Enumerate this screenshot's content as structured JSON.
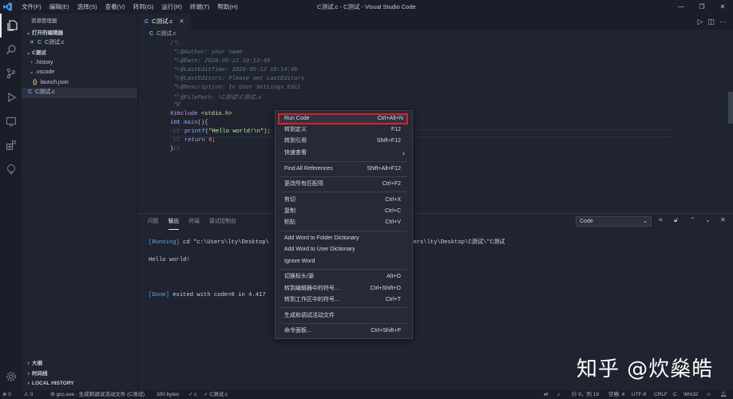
{
  "titlebar": {
    "menu": [
      "文件(F)",
      "编辑(E)",
      "选择(S)",
      "查看(V)",
      "转到(G)",
      "运行(R)",
      "终端(T)",
      "帮助(H)"
    ],
    "title": "C测试.c - C测试 - Visual Studio Code",
    "controls": [
      "—",
      "❐",
      "✕"
    ]
  },
  "sidebar": {
    "title": "资源管理器",
    "open_editors_header": "打开的编辑器",
    "open_editor_item": "C测试.c",
    "folder_header": "C测试",
    "tree": [
      {
        "label": ".history",
        "kind": "folder"
      },
      {
        "label": ".vscode",
        "kind": "folder-open"
      },
      {
        "label": "launch.json",
        "kind": "json"
      },
      {
        "label": "C测试.c",
        "kind": "c"
      }
    ],
    "bottom_sections": [
      "大纲",
      "时间线",
      "LOCAL HISTORY"
    ]
  },
  "editor": {
    "tab_label": "C测试.c",
    "breadcrumb": "C测试.c",
    "line_numbers": [
      "1",
      "2",
      "3",
      "4",
      "5",
      "6",
      "7",
      "8",
      "9",
      "10",
      "11",
      "12",
      "13"
    ],
    "comment_lines": [
      "/*",
      " * @Author: your name",
      " * @Date: 2020-05-12 10:13:45",
      " * @LastEditTime: 2020-05-12 10:14:40",
      " * @LastEditors: Please set LastEditors",
      " * @Description: In User Settings Edit",
      " * @FilePath: \\C测试\\C测试.c",
      " */"
    ],
    "include_kw": "#include",
    "include_file": " <stdio.h>",
    "main_kw": "int",
    "main_fn": " main",
    "main_rest": "(){",
    "printf_fn": "printf",
    "printf_open": "(",
    "printf_str": "\"Hello world!\\n\"",
    "printf_close": ");",
    "return_kw": "return",
    "return_val": " 0",
    "return_semi": ";",
    "close_brace": "}"
  },
  "panel": {
    "tabs": [
      "问题",
      "输出",
      "终端",
      "调试控制台"
    ],
    "active_tab": "输出",
    "output_select": "Code",
    "output_line1_tag": "[Running]",
    "output_line1_text": " cd \"c:\\Users\\lty\\Desktop\\",
    "output_line1_tail": "sers\\lty\\Desktop\\C测试\\\"C测试",
    "output_line2": "Hello world!",
    "output_line3_tag": "[Done]",
    "output_line3_text": " exited with code=0 in 4.417"
  },
  "context_menu": [
    {
      "label": "Run Code",
      "shortcut": "Ctrl+Alt+N",
      "highlighted": true
    },
    {
      "label": "转到定义",
      "shortcut": "F12"
    },
    {
      "label": "转到引用",
      "shortcut": "Shift+F12"
    },
    {
      "label": "快速查看",
      "shortcut": "›"
    },
    {
      "label": "Find All References",
      "shortcut": "Shift+Alt+F12"
    },
    {
      "label": "更改所有匹配项",
      "shortcut": "Ctrl+F2"
    },
    {
      "label": "剪切",
      "shortcut": "Ctrl+X"
    },
    {
      "label": "复制",
      "shortcut": "Ctrl+C"
    },
    {
      "label": "粘贴",
      "shortcut": "Ctrl+V"
    },
    {
      "label": "Add Word to Folder Dictionary",
      "shortcut": ""
    },
    {
      "label": "Add Word to User Dictionary",
      "shortcut": ""
    },
    {
      "label": "Ignore Word",
      "shortcut": ""
    },
    {
      "label": "切换标头/源",
      "shortcut": "Alt+O"
    },
    {
      "label": "转到编辑器中的符号...",
      "shortcut": "Ctrl+Shift+O"
    },
    {
      "label": "转到工作区中的符号...",
      "shortcut": "Ctrl+T"
    },
    {
      "label": "生成和调试活动文件",
      "shortcut": ""
    },
    {
      "label": "命令面板...",
      "shortcut": "Ctrl+Shift+P"
    }
  ],
  "statusbar": {
    "errors": "⊗ 0",
    "warnings": "⚠ 0",
    "debug_config": "⚙ gcc.exe - 生成和调试活动文件 (C测试)",
    "file_size": "300 bytes",
    "check": "✓ c",
    "file_check": "✓ C测试.c",
    "cursor": "行 9，列 19",
    "spaces": "空格: 4",
    "encoding": "UTF-8",
    "eol": "CRLF",
    "language": "C",
    "platform": "Win32"
  },
  "watermark": "知乎 @炊燊皓",
  "colors": {
    "background": "#1f2430",
    "accent": "#5fa8e6",
    "highlight_border": "#e02020"
  }
}
